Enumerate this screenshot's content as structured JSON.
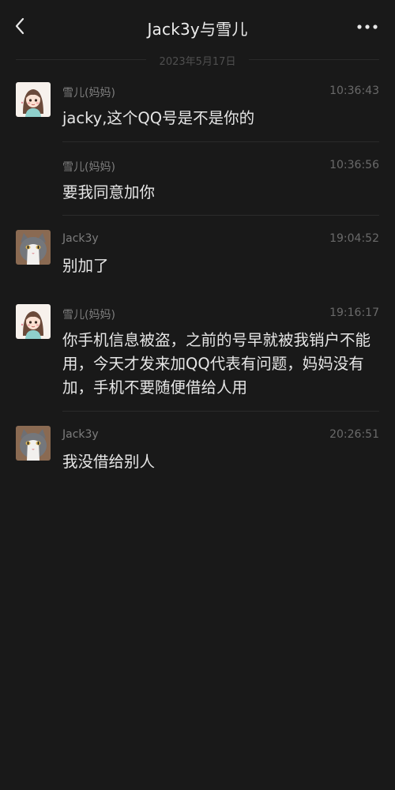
{
  "header": {
    "title": "Jack3y与雪儿",
    "back_icon": "chevron-left-icon",
    "more_icon": "more-dots-icon"
  },
  "date_separator": "2023年5月17日",
  "messages": [
    {
      "sender": "雪儿(妈妈)",
      "time": "10:36:43",
      "text": "jacky,这个QQ号是不是你的",
      "avatar": "girl-avatar"
    },
    {
      "sender": "雪儿(妈妈)",
      "time": "10:36:56",
      "text": "要我同意加你",
      "avatar": ""
    },
    {
      "sender": "Jack3y",
      "time": "19:04:52",
      "text": "别加了",
      "avatar": "cat-avatar"
    },
    {
      "sender": "雪儿(妈妈)",
      "time": "19:16:17",
      "text": "你手机信息被盗，之前的号早就被我销户不能用，今天才发来加QQ代表有问题，妈妈没有加，手机不要随便借给人用",
      "avatar": "girl-avatar"
    },
    {
      "sender": "Jack3y",
      "time": "20:26:51",
      "text": "我没借给别人",
      "avatar": "cat-avatar"
    }
  ]
}
